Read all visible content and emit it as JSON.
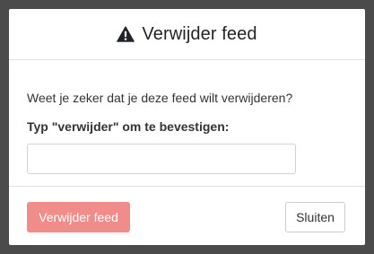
{
  "modal": {
    "title": "Verwijder feed",
    "title_icon": "warning-triangle-icon",
    "question": "Weet je zeker dat je deze feed wilt verwijderen?",
    "confirm_label": "Typ \"verwijder\" om te bevestigen:",
    "confirm_input": {
      "value": "",
      "placeholder": ""
    },
    "delete_button_label": "Verwijder feed",
    "close_button_label": "Sluiten"
  },
  "colors": {
    "backdrop": "#4b4b4b",
    "delete_button": "#f08c8a",
    "title_text": "#212529",
    "divider": "#dee2e6"
  }
}
